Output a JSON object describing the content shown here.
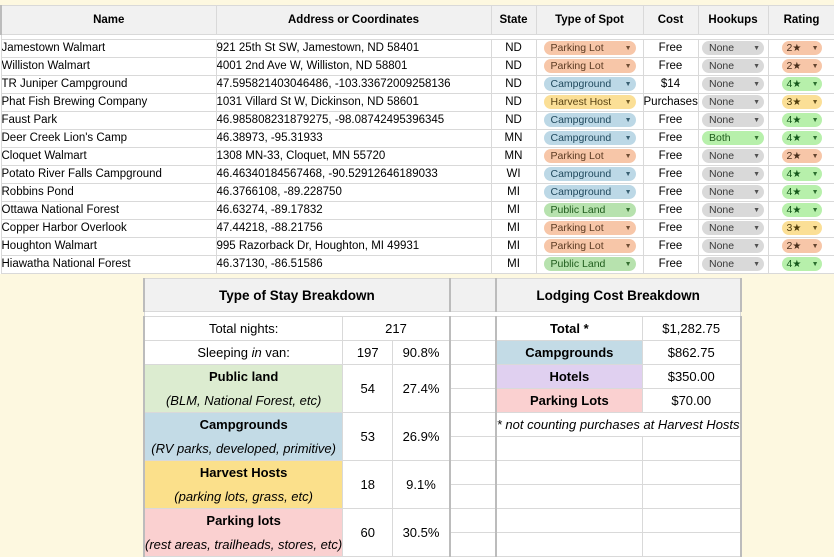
{
  "colors": {
    "page_background": "#fdf8e0",
    "header_background": "#f1f1f1",
    "header_band": "#c9c9c9",
    "grid_line": "#d9d9d9",
    "parking_lot": "#f7c6a8",
    "campground": "#bcd8e6",
    "harvest_host": "#fbdf96",
    "public_land": "#b7e2ae",
    "hookup_none": "#d9d9d9",
    "hookup_both": "#b7f0ab",
    "cost_free_text": "#1f8a4c",
    "cost_money_text": "#e0b000",
    "cost_purchases_text": "#5b8fd6",
    "hotels_row": "#e0d0f0"
  },
  "spots_table": {
    "columns": [
      "Name",
      "Address or Coordinates",
      "State",
      "Type of Spot",
      "Cost",
      "Hookups",
      "Rating"
    ],
    "rows": [
      {
        "name": "Jamestown Walmart",
        "address": "921 25th St SW, Jamestown, ND  58401",
        "state": "ND",
        "type": "Parking Lot",
        "type_style": "c-parking",
        "cost": "Free",
        "cost_style": "cost-free",
        "hookups": "None",
        "hookups_style": "c-none",
        "rating": "2",
        "rating_style": "r-orange"
      },
      {
        "name": "Williston Walmart",
        "address": "4001 2nd Ave W, Williston, ND 58801",
        "state": "ND",
        "type": "Parking Lot",
        "type_style": "c-parking",
        "cost": "Free",
        "cost_style": "cost-free",
        "hookups": "None",
        "hookups_style": "c-none",
        "rating": "2",
        "rating_style": "r-orange"
      },
      {
        "name": "TR Juniper Campground",
        "address": "47.595821403046486, -103.33672009258136",
        "state": "ND",
        "type": "Campground",
        "type_style": "c-campgr",
        "cost": "$14",
        "cost_style": "cost-money",
        "hookups": "None",
        "hookups_style": "c-none",
        "rating": "4",
        "rating_style": "r-green"
      },
      {
        "name": "Phat Fish Brewing Company",
        "address": "1031 Villard St W, Dickinson, ND 58601",
        "state": "ND",
        "type": "Harvest Host",
        "type_style": "c-harvest",
        "cost": "Purchases",
        "cost_style": "cost-purch",
        "hookups": "None",
        "hookups_style": "c-none",
        "rating": "3",
        "rating_style": "r-yellow"
      },
      {
        "name": "Faust Park",
        "address": "46.985808231879275, -98.08742495396345",
        "state": "ND",
        "type": "Campground",
        "type_style": "c-campgr",
        "cost": "Free",
        "cost_style": "cost-free",
        "hookups": "None",
        "hookups_style": "c-none",
        "rating": "4",
        "rating_style": "r-green"
      },
      {
        "name": "Deer Creek Lion's Camp",
        "address": "46.38973, -95.31933",
        "state": "MN",
        "type": "Campground",
        "type_style": "c-campgr",
        "cost": "Free",
        "cost_style": "cost-free",
        "hookups": "Both",
        "hookups_style": "c-both",
        "rating": "4",
        "rating_style": "r-green"
      },
      {
        "name": "Cloquet Walmart",
        "address": "1308 MN-33, Cloquet, MN 55720",
        "state": "MN",
        "type": "Parking Lot",
        "type_style": "c-parking",
        "cost": "Free",
        "cost_style": "cost-free",
        "hookups": "None",
        "hookups_style": "c-none",
        "rating": "2",
        "rating_style": "r-orange"
      },
      {
        "name": "Potato River Falls Campground",
        "address": "46.46340184567468, -90.52912646189033",
        "state": "WI",
        "type": "Campground",
        "type_style": "c-campgr",
        "cost": "Free",
        "cost_style": "cost-free",
        "hookups": "None",
        "hookups_style": "c-none",
        "rating": "4",
        "rating_style": "r-green"
      },
      {
        "name": "Robbins Pond",
        "address": "46.3766108, -89.228750",
        "state": "MI",
        "type": "Campground",
        "type_style": "c-campgr",
        "cost": "Free",
        "cost_style": "cost-free",
        "hookups": "None",
        "hookups_style": "c-none",
        "rating": "4",
        "rating_style": "r-green"
      },
      {
        "name": "Ottawa National Forest",
        "address": "46.63274, -89.17832",
        "state": "MI",
        "type": "Public Land",
        "type_style": "c-public",
        "cost": "Free",
        "cost_style": "cost-free",
        "hookups": "None",
        "hookups_style": "c-none",
        "rating": "4",
        "rating_style": "r-green"
      },
      {
        "name": "Copper Harbor Overlook",
        "address": "47.44218, -88.21756",
        "state": "MI",
        "type": "Parking Lot",
        "type_style": "c-parking",
        "cost": "Free",
        "cost_style": "cost-free",
        "hookups": "None",
        "hookups_style": "c-none",
        "rating": "3",
        "rating_style": "r-yellow"
      },
      {
        "name": "Houghton Walmart",
        "address": "995 Razorback Dr, Houghton, MI 49931",
        "state": "MI",
        "type": "Parking Lot",
        "type_style": "c-parking",
        "cost": "Free",
        "cost_style": "cost-free",
        "hookups": "None",
        "hookups_style": "c-none",
        "rating": "2",
        "rating_style": "r-orange"
      },
      {
        "name": "Hiawatha National Forest",
        "address": "46.37130, -86.51586",
        "state": "MI",
        "type": "Public Land",
        "type_style": "c-public",
        "cost": "Free",
        "cost_style": "cost-free",
        "hookups": "None",
        "hookups_style": "c-none",
        "rating": "4",
        "rating_style": "r-green"
      }
    ]
  },
  "stay_breakdown": {
    "title": "Type of Stay Breakdown",
    "total_nights_label": "Total nights:",
    "total_nights_value": "217",
    "sleeping_label_pre": "Sleeping ",
    "sleeping_label_em": "in",
    "sleeping_label_post": " van:",
    "sleeping_count": "197",
    "sleeping_pct": "90.8%",
    "categories": [
      {
        "name": "Public land",
        "sub": "(BLM, National Forest, etc)",
        "count": "54",
        "pct": "27.4%",
        "style": "bg-public"
      },
      {
        "name": "Campgrounds",
        "sub": "(RV parks, developed, primitive)",
        "count": "53",
        "pct": "26.9%",
        "style": "bg-campgr"
      },
      {
        "name": "Harvest Hosts",
        "sub": "(parking lots, grass, etc)",
        "count": "18",
        "pct": "9.1%",
        "style": "bg-harvest"
      },
      {
        "name": "Parking lots",
        "sub": "(rest areas, trailheads, stores, etc)",
        "count": "60",
        "pct": "30.5%",
        "style": "bg-parking"
      }
    ]
  },
  "lodging_breakdown": {
    "title": "Lodging Cost Breakdown",
    "rows": [
      {
        "label": "Total *",
        "value": "$1,282.75",
        "style": ""
      },
      {
        "label": "Campgrounds",
        "value": "$862.75",
        "style": "bg-campgr2"
      },
      {
        "label": "Hotels",
        "value": "$350.00",
        "style": "bg-hotels"
      },
      {
        "label": "Parking Lots",
        "value": "$70.00",
        "style": "bg-parking2"
      }
    ],
    "footnote": "* not counting purchases at Harvest Hosts"
  }
}
